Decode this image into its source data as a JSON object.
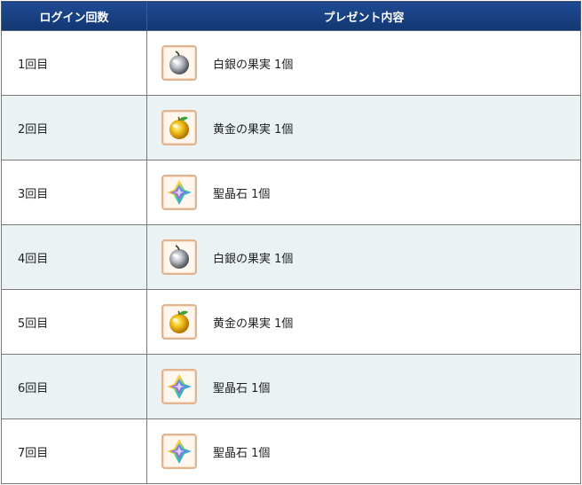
{
  "table": {
    "headers": {
      "count": "ログイン回数",
      "gift": "プレゼント内容"
    },
    "rows": [
      {
        "count": "1回目",
        "gift": "白銀の果実 1個",
        "icon": "silver-fruit-icon"
      },
      {
        "count": "2回目",
        "gift": "黄金の果実 1個",
        "icon": "golden-fruit-icon"
      },
      {
        "count": "3回目",
        "gift": "聖晶石 1個",
        "icon": "saint-quartz-icon"
      },
      {
        "count": "4回目",
        "gift": "白銀の果実 1個",
        "icon": "silver-fruit-icon"
      },
      {
        "count": "5回目",
        "gift": "黄金の果実 1個",
        "icon": "golden-fruit-icon"
      },
      {
        "count": "6回目",
        "gift": "聖晶石 1個",
        "icon": "saint-quartz-icon"
      },
      {
        "count": "7回目",
        "gift": "聖晶石 1個",
        "icon": "saint-quartz-icon"
      }
    ]
  },
  "colors": {
    "header_bg": "#1a4184",
    "alt_row_bg": "#eaf2f4",
    "border": "#7a7a7a"
  }
}
